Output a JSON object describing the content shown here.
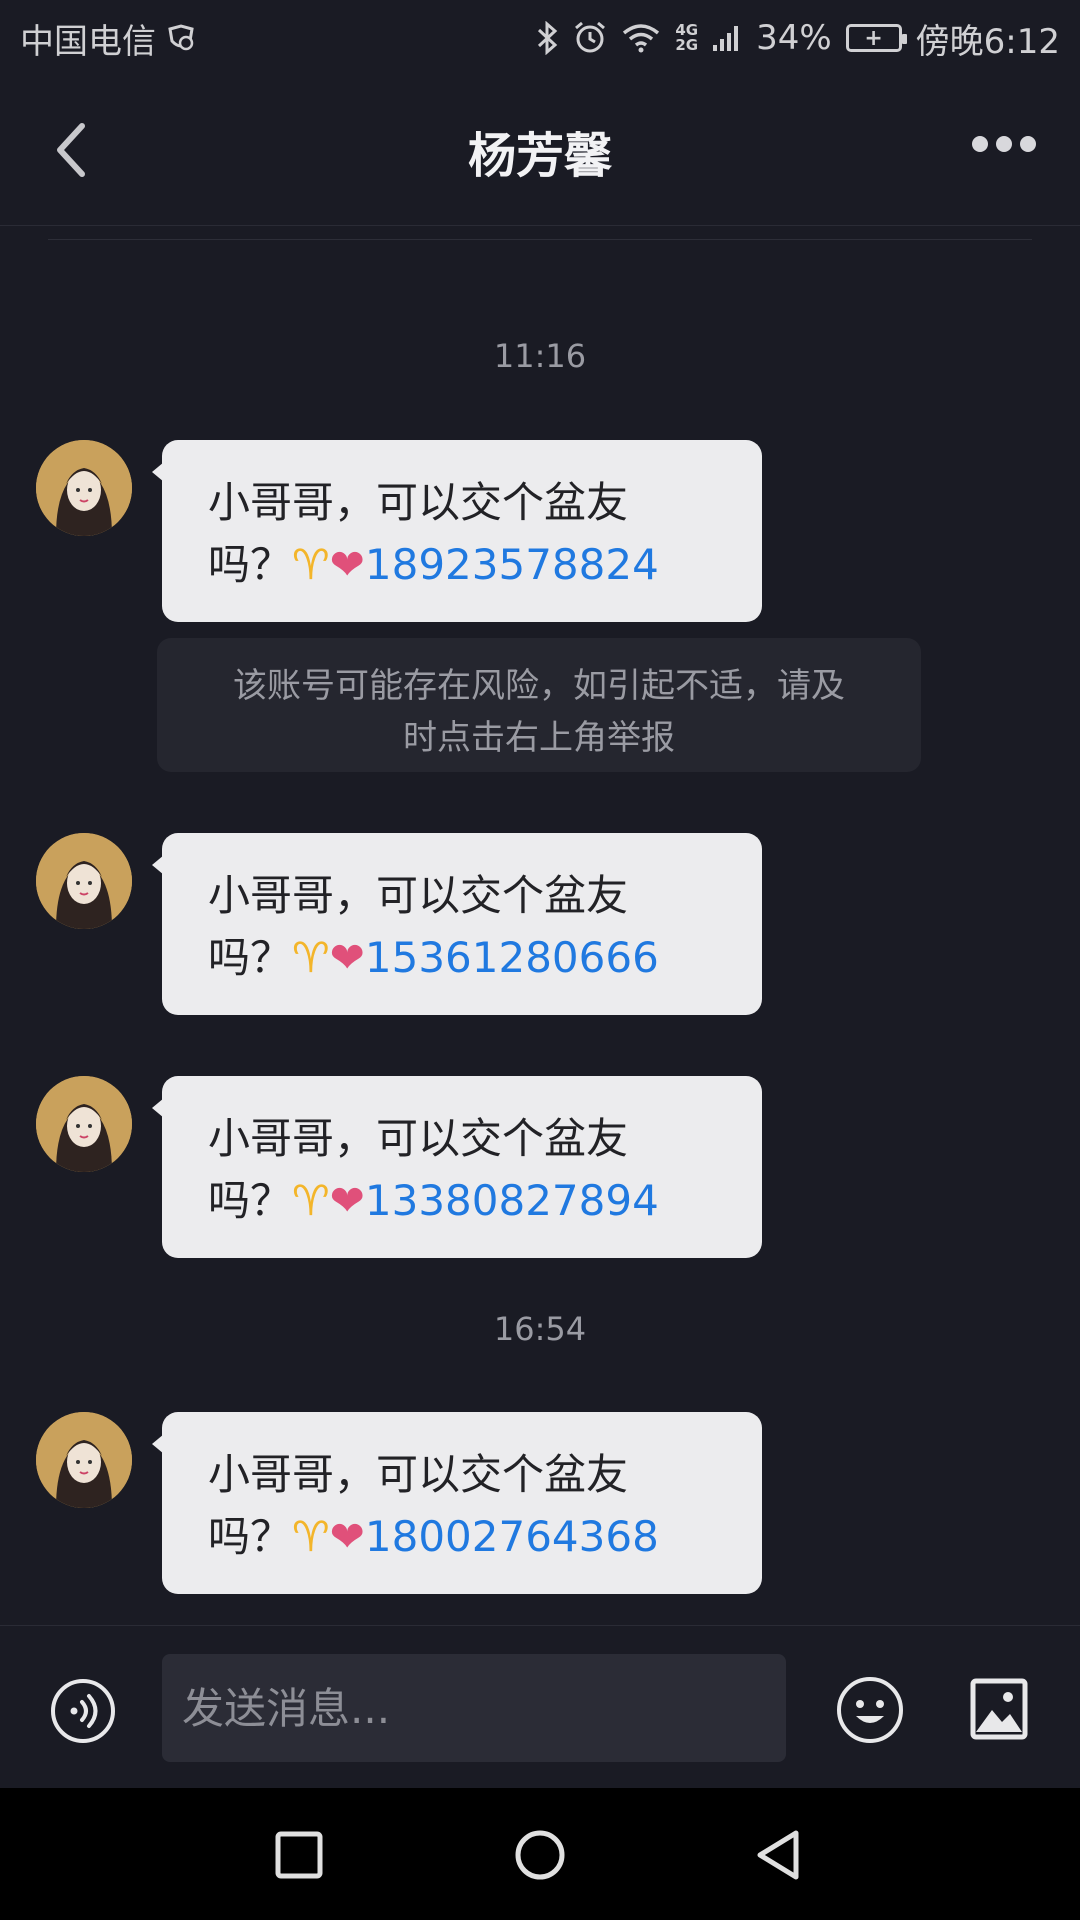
{
  "status_bar": {
    "carrier": "中国电信",
    "network_top": "4G",
    "network_bottom": "2G",
    "battery_percent": "34%",
    "time": "傍晚6:12"
  },
  "header": {
    "title": "杨芳馨"
  },
  "chat": {
    "timestamps": [
      "11:16",
      "16:54"
    ],
    "messages": [
      {
        "line1": "小哥哥，可以交个盆友",
        "line2_prefix": "吗？",
        "aries": "♈",
        "heart": "❤",
        "phone": "18923578824"
      },
      {
        "line1": "小哥哥，可以交个盆友",
        "line2_prefix": "吗？",
        "aries": "♈",
        "heart": "❤",
        "phone": "15361280666"
      },
      {
        "line1": "小哥哥，可以交个盆友",
        "line2_prefix": "吗？",
        "aries": "♈",
        "heart": "❤",
        "phone": "13380827894"
      },
      {
        "line1": "小哥哥，可以交个盆友",
        "line2_prefix": "吗？",
        "aries": "♈",
        "heart": "❤",
        "phone": "18002764368"
      }
    ],
    "warning_line1": "该账号可能存在风险，如引起不适，请及",
    "warning_line2": "时点击右上角举报"
  },
  "input_bar": {
    "placeholder": "发送消息..."
  },
  "colors": {
    "background": "#1a1b24",
    "bubble": "#ececee",
    "phone_link": "#2079e0",
    "aries": "#f3b52a",
    "heart": "#e0507a"
  }
}
